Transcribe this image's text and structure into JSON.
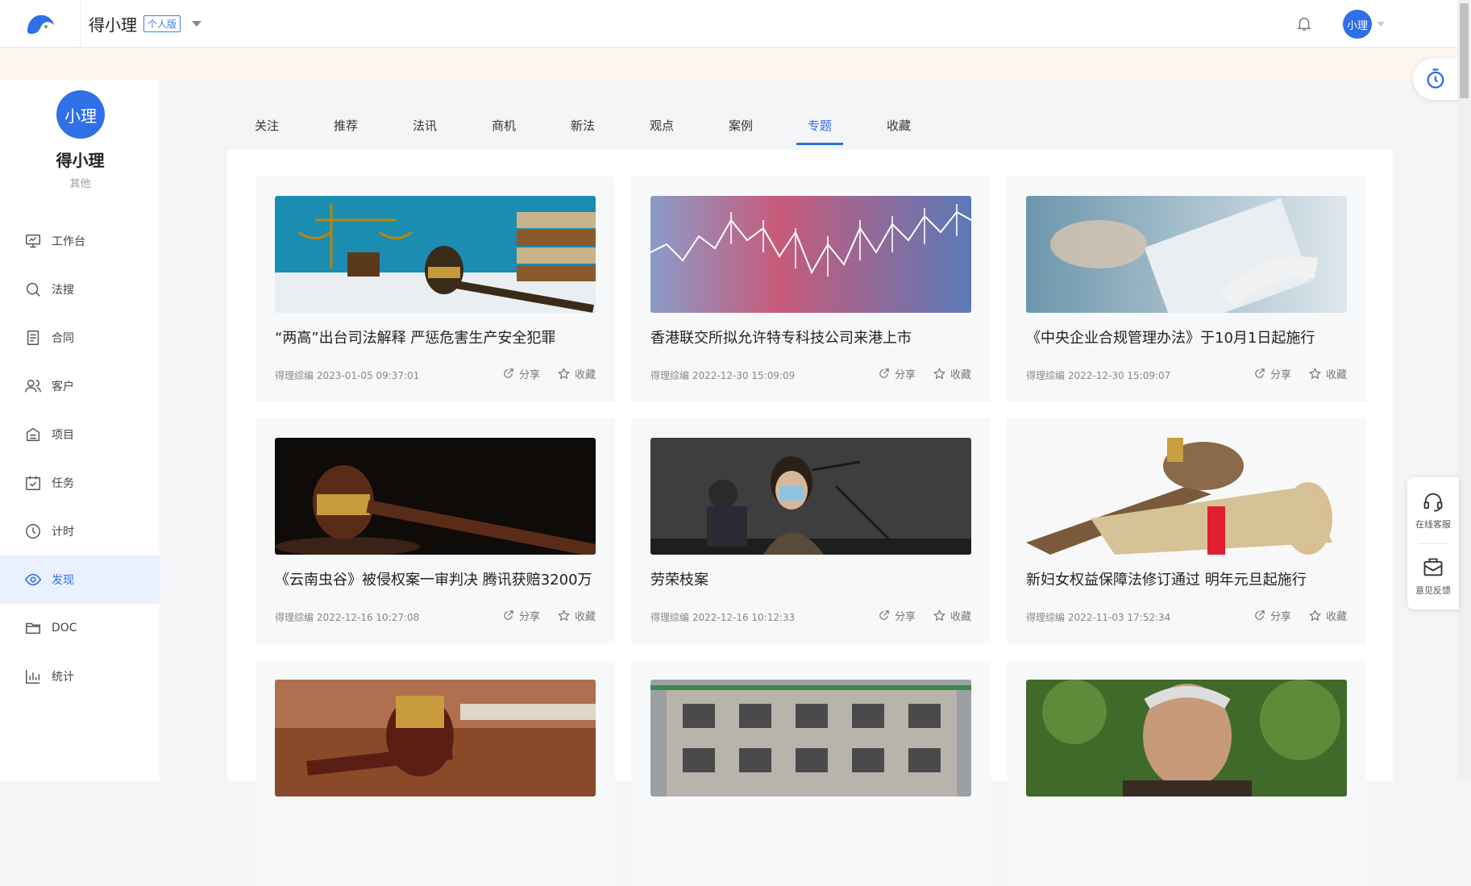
{
  "topbar": {
    "brand": "得小理",
    "edition": "个人版",
    "avatar_text": "小理"
  },
  "sidebar": {
    "avatar_text": "小理",
    "name": "得小理",
    "role": "其他",
    "items": [
      {
        "label": "工作台",
        "icon": "monitor-icon"
      },
      {
        "label": "法搜",
        "icon": "search-icon"
      },
      {
        "label": "合同",
        "icon": "document-icon"
      },
      {
        "label": "客户",
        "icon": "users-icon"
      },
      {
        "label": "项目",
        "icon": "project-icon"
      },
      {
        "label": "任务",
        "icon": "calendar-check-icon"
      },
      {
        "label": "计时",
        "icon": "clock-icon"
      },
      {
        "label": "发现",
        "icon": "eye-icon",
        "active": true
      },
      {
        "label": "DOC",
        "icon": "folder-icon"
      },
      {
        "label": "统计",
        "icon": "bar-chart-icon"
      }
    ]
  },
  "tabs": [
    "关注",
    "推荐",
    "法讯",
    "商机",
    "新法",
    "观点",
    "案例",
    "专题",
    "收藏"
  ],
  "active_tab": "专题",
  "actions": {
    "share": "分享",
    "favorite": "收藏"
  },
  "cards": [
    {
      "title": "“两高”出台司法解释 严惩危害生产安全犯罪",
      "author": "得理综编",
      "time": "2023-01-05 09:37:01"
    },
    {
      "title": "香港联交所拟允许特专科技公司来港上市",
      "author": "得理综编",
      "time": "2022-12-30 15:09:09"
    },
    {
      "title": "《中央企业合规管理办法》于10月1日起施行",
      "author": "得理综编",
      "time": "2022-12-30 15:09:07"
    },
    {
      "title": "《云南虫谷》被侵权案一审判决 腾讯获赔3200万",
      "author": "得理综编",
      "time": "2022-12-16 10:27:08"
    },
    {
      "title": "劳荣枝案",
      "author": "得理综编",
      "time": "2022-12-16 10:12:33"
    },
    {
      "title": "新妇女权益保障法修订通过 明年元旦起施行",
      "author": "得理综编",
      "time": "2022-11-03 17:52:34"
    },
    {
      "title": "",
      "author": "",
      "time": ""
    },
    {
      "title": "",
      "author": "",
      "time": ""
    },
    {
      "title": "",
      "author": "",
      "time": ""
    }
  ],
  "float_panel": {
    "service": "在线客服",
    "feedback": "意见反馈"
  },
  "colors": {
    "accent": "#2f6fe8",
    "notice_bg": "#fdf6ec"
  }
}
